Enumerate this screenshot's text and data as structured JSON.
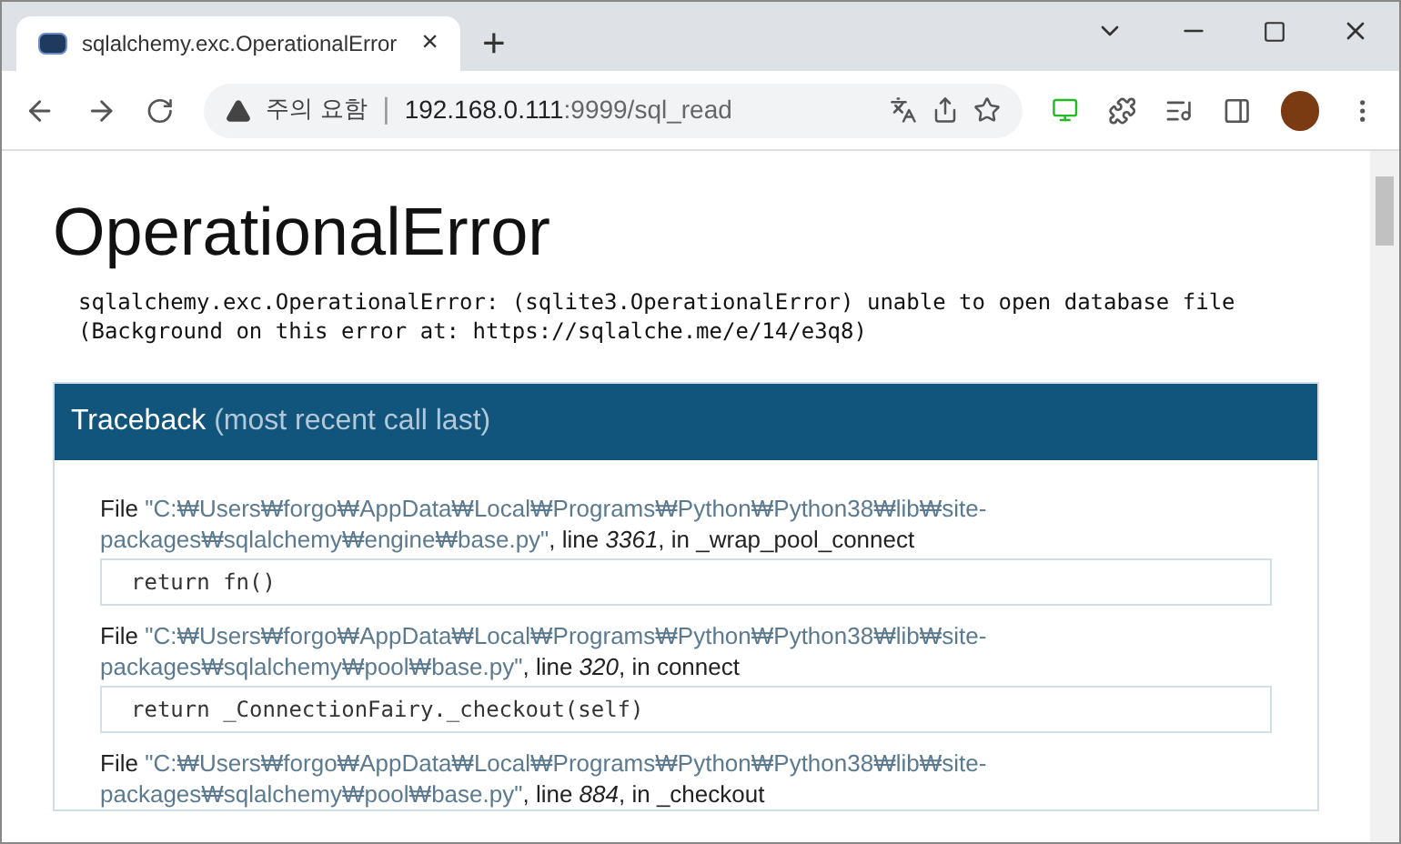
{
  "tab": {
    "title": "sqlalchemy.exc.OperationalError",
    "close": "×",
    "new_tab": "+"
  },
  "address_bar": {
    "security_label": "주의 요함",
    "separator": "|",
    "url_host": "192.168.0.111",
    "url_rest": ":9999/sql_read"
  },
  "page": {
    "title": "OperationalError",
    "message": [
      "sqlalchemy.exc.OperationalError: (sqlite3.OperationalError) unable to open database file",
      "(Background on this error at: https://sqlalche.me/e/14/e3q8)"
    ],
    "traceback": {
      "title": "Traceback",
      "subtitle": "(most recent call last)",
      "frames": [
        {
          "label": "File",
          "path": "\"C:₩Users₩forgo₩AppData₩Local₩Programs₩Python₩Python38₩lib₩site-packages₩sqlalchemy₩engine₩base.py\"",
          "location": ", line *3361*, in _wrap_pool_connect",
          "code": "return fn()"
        },
        {
          "label": "File",
          "path": "\"C:₩Users₩forgo₩AppData₩Local₩Programs₩Python₩Python38₩lib₩site-packages₩sqlalchemy₩pool₩base.py\"",
          "location": ", line *320*, in connect",
          "code": "return _ConnectionFairy._checkout(self)"
        },
        {
          "label": "File",
          "path": "\"C:₩Users₩forgo₩AppData₩Local₩Programs₩Python₩Python38₩lib₩site-packages₩sqlalchemy₩pool₩base.py\"",
          "location": ", line *884*, in _checkout"
        }
      ]
    }
  }
}
